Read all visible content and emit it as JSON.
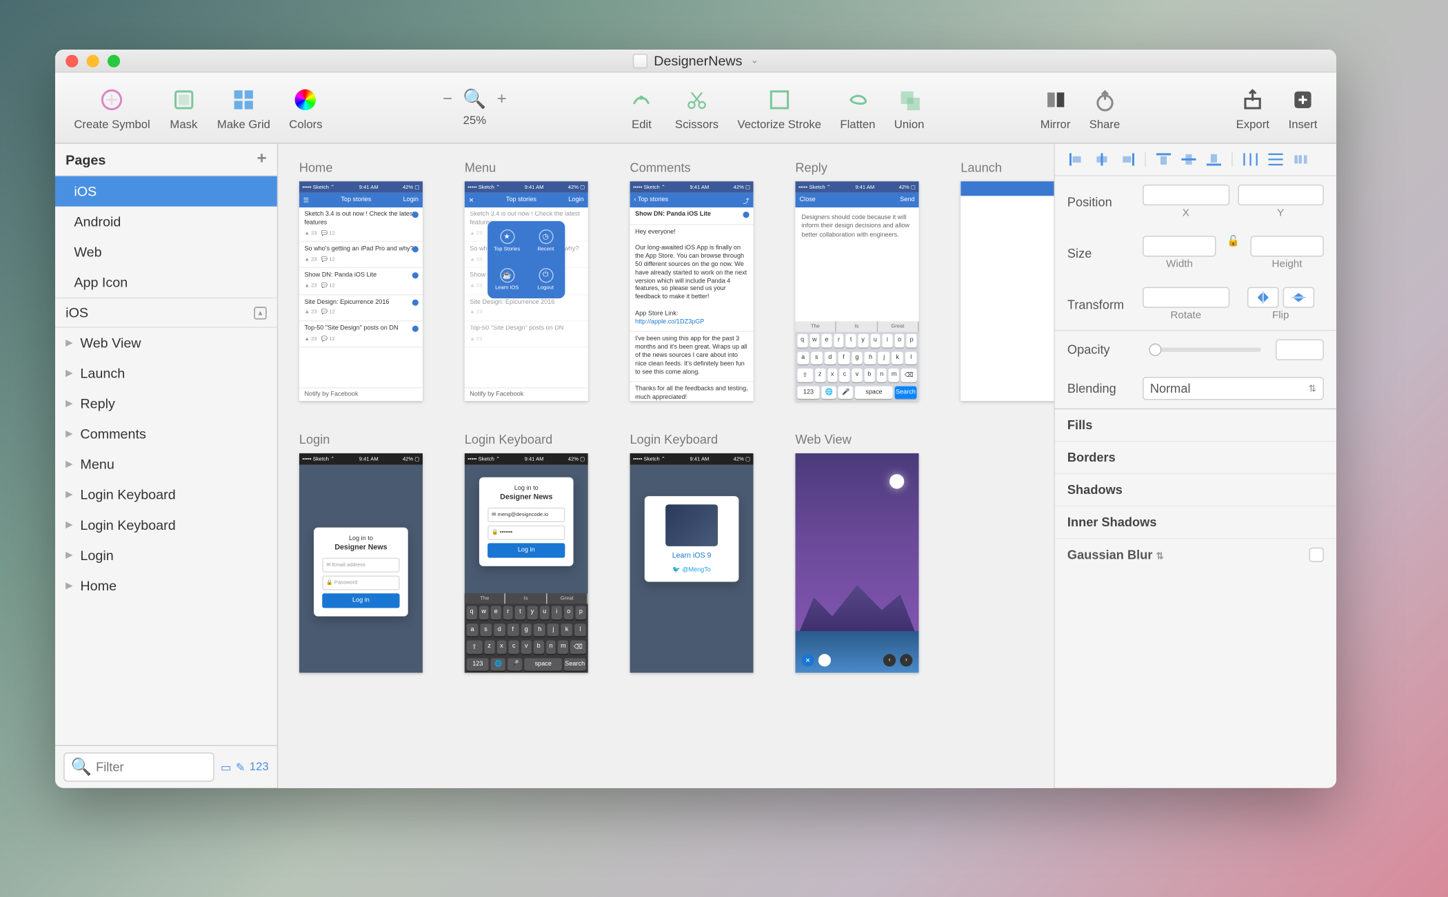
{
  "title": "DesignerNews",
  "toolbar": {
    "create_symbol": "Create Symbol",
    "mask": "Mask",
    "make_grid": "Make Grid",
    "colors": "Colors",
    "zoom_level": "25%",
    "edit": "Edit",
    "scissors": "Scissors",
    "vectorize": "Vectorize Stroke",
    "flatten": "Flatten",
    "union": "Union",
    "mirror": "Mirror",
    "share": "Share",
    "export": "Export",
    "insert": "Insert"
  },
  "sidebar": {
    "pages_label": "Pages",
    "pages": [
      "iOS",
      "Android",
      "Web",
      "App Icon"
    ],
    "selected_page": 0,
    "section_label": "iOS",
    "layers": [
      "Web View",
      "Launch",
      "Reply",
      "Comments",
      "Menu",
      "Login Keyboard",
      "Login Keyboard",
      "Login",
      "Home"
    ],
    "filter_placeholder": "Filter",
    "layer_count": "123"
  },
  "canvas": {
    "artboards": [
      {
        "title": "Home",
        "type": "list"
      },
      {
        "title": "Menu",
        "type": "menu"
      },
      {
        "title": "Comments",
        "type": "comments"
      },
      {
        "title": "Reply",
        "type": "reply"
      },
      {
        "title": "Launch",
        "type": "launch"
      },
      {
        "title": "Login",
        "type": "login"
      },
      {
        "title": "Login Keyboard",
        "type": "login-kb"
      },
      {
        "title": "Login Keyboard",
        "type": "learn"
      },
      {
        "title": "Web View",
        "type": "webview"
      }
    ],
    "list_nav": "Top stories",
    "list_login": "Login",
    "list_items": [
      "Sketch 3.4 is out now ! Check the latest features",
      "So who's getting an iPad Pro and why?",
      "Show DN: Panda iOS Lite",
      "Site Design: Epicurrence 2016",
      "Top-50 \"Site Design\" posts on DN"
    ],
    "list_footer": "Notify by Facebook",
    "menu_items": [
      "Top Stories",
      "Recent",
      "Learn iOS",
      "Logout"
    ],
    "comments_title": "Show DN: Panda iOS Lite",
    "comments_greeting": "Hey everyone!",
    "comments_body": "Our long-awaited iOS App is finally on the App Store. You can browse through 50 different sources on the go now. We have already started to work on the next version which will include Panda 4 features, so please send us your feedback to make it better!",
    "comments_link_label": "App Store Link:",
    "comments_link": "http://apple.co/1DZ3pGP",
    "comments_feedback": "Thanks for all the feedbacks and testing, much appreciated!",
    "comments_reply_body": "I've been using this app for the past 3 months and it's been great. Wraps up all of the news sources I care about into nice clean feeds. It's definitely been fun to see this come along.",
    "reply_nav_close": "Close",
    "reply_nav_send": "Send",
    "reply_body": "Designers should code because it will inform their design decisions and allow better collaboration with engineers.",
    "kb_hints": [
      "The",
      "Is",
      "Great"
    ],
    "kb_space": "space",
    "kb_search": "Search",
    "login_title": "Log in to",
    "login_subtitle": "Designer News",
    "login_email_ph": "Email address",
    "login_password_ph": "Password",
    "login_btn": "Log in",
    "login_email_value": "meng@designcode.io",
    "login_pw_value": "•••••••",
    "learn_title": "Learn iOS 9",
    "learn_handle": "@MengTo"
  },
  "inspector": {
    "position_label": "Position",
    "x_label": "X",
    "y_label": "Y",
    "size_label": "Size",
    "width_label": "Width",
    "height_label": "Height",
    "transform_label": "Transform",
    "rotate_label": "Rotate",
    "flip_label": "Flip",
    "opacity_label": "Opacity",
    "blending_label": "Blending",
    "blending_value": "Normal",
    "fills": "Fills",
    "borders": "Borders",
    "shadows": "Shadows",
    "inner_shadows": "Inner Shadows",
    "gaussian": "Gaussian Blur"
  }
}
